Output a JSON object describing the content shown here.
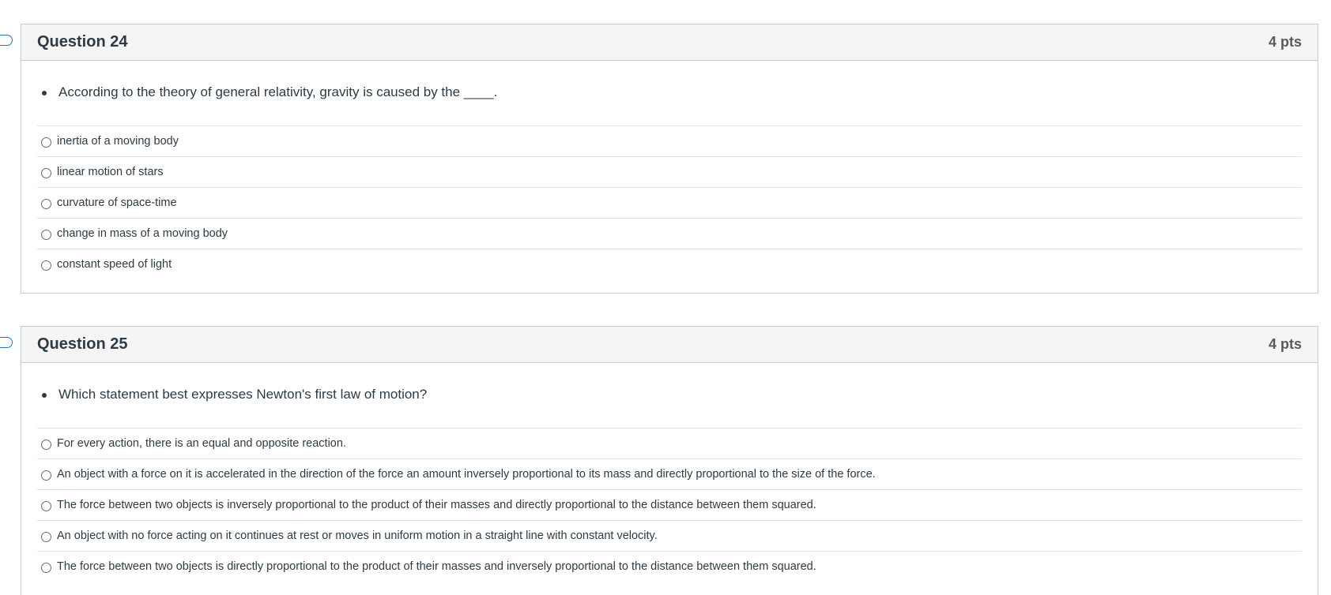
{
  "questions": [
    {
      "title": "Question 24",
      "points": "4 pts",
      "prompt": "According to the theory of general relativity, gravity is caused by the ____.",
      "answers": [
        "inertia of a moving body",
        "linear motion of stars",
        "curvature of space-time",
        "change in mass of a moving body",
        "constant speed of light"
      ]
    },
    {
      "title": "Question 25",
      "points": "4 pts",
      "prompt": "Which statement best expresses Newton's first law of motion?",
      "answers": [
        "For every action, there is an equal and opposite reaction.",
        "An object with a force on it is accelerated in the direction of the force an amount inversely proportional to its mass and directly proportional to the size of the force.",
        "The force between two objects is inversely proportional to the product of their masses and directly proportional to the distance between them squared.",
        "An object with no force acting on it continues at rest or moves in uniform motion in a straight line with constant velocity.",
        "The force between two objects is directly proportional to the product of their masses and inversely proportional to the distance between them squared."
      ]
    }
  ]
}
